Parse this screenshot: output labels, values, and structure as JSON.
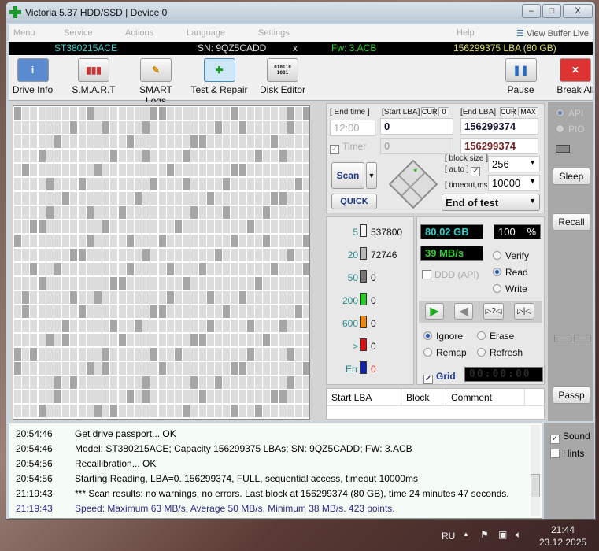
{
  "window": {
    "title": "Victoria 5.37 HDD/SSD | Device 0",
    "minimize": "–",
    "maximize": "□",
    "close": "X"
  },
  "menu": [
    "Menu",
    "Service",
    "Actions",
    "Language",
    "Settings",
    "Help"
  ],
  "view_buffer": "View Buffer Live",
  "info": {
    "model": "ST380215ACE",
    "serial": "SN: 9QZ5CADD",
    "close": "x",
    "firmware": "Fw: 3.ACB",
    "capacity": "156299375 LBA (80 GB)"
  },
  "toolbar": {
    "drive_info": "Drive Info",
    "smart": "S.M.A.R.T",
    "smart_logs": "SMART Logs",
    "test_repair": "Test & Repair",
    "disk_editor": "Disk Editor",
    "pause": "Pause",
    "break_all": "Break All"
  },
  "controls": {
    "end_time_label": "[ End time ]",
    "end_time": "12:00",
    "start_lba_label": "[Start LBA]",
    "cur": "CUR",
    "zero": "0",
    "end_lba_label": "[End LBA]",
    "max": "MAX",
    "start_lba": "0",
    "end_lba": "156299374",
    "timer": "Timer",
    "timer_value": "0",
    "end_lba2": "156299374",
    "scan": "Scan",
    "quick": "QUICK",
    "block_size_label": "[ block size ]",
    "auto_label": "[ auto ]",
    "block_size": "256",
    "timeout_label": "[ timeout,ms ]",
    "timeout": "10000",
    "end_action": "End of test"
  },
  "legend": [
    {
      "ms": "5",
      "count": "537800",
      "color": "#f4f4f4"
    },
    {
      "ms": "20",
      "count": "72746",
      "color": "#b8b8b8"
    },
    {
      "ms": "50",
      "count": "0",
      "color": "#777777"
    },
    {
      "ms": "200",
      "count": "0",
      "color": "#22cc22"
    },
    {
      "ms": "600",
      "count": "0",
      "color": "#ee8811"
    },
    {
      "ms": ">",
      "count": "0",
      "color": "#dd1111"
    },
    {
      "ms": "Err",
      "count": "0",
      "color": "#1122aa"
    }
  ],
  "status": {
    "size": "80,02 GB",
    "percent": "100",
    "percent_sign": "%",
    "speed": "39 MB/s",
    "ddd": "DDD (API)",
    "verify": "Verify",
    "read": "Read",
    "write": "Write",
    "ignore": "Ignore",
    "erase": "Erase",
    "remap": "Remap",
    "refresh": "Refresh",
    "grid": "Grid",
    "clock": "00:00:00"
  },
  "table": {
    "headers": [
      "Start LBA",
      "Block",
      "Comment"
    ]
  },
  "side": {
    "api": "API",
    "pio": "PIO",
    "sleep": "Sleep",
    "recall": "Recall",
    "passp": "Passp"
  },
  "log": [
    {
      "time": "20:54:46",
      "text": "Get drive passport... OK"
    },
    {
      "time": "20:54:46",
      "text": "Model: ST380215ACE; Capacity 156299375 LBAs; SN: 9QZ5CADD; FW: 3.ACB"
    },
    {
      "time": "20:54:56",
      "text": "Recallibration... OK"
    },
    {
      "time": "20:54:56",
      "text": "Starting Reading, LBA=0..156299374, FULL, sequential access, timeout 10000ms"
    },
    {
      "time": "21:19:43",
      "text": "*** Scan results: no warnings, no errors. Last block at 156299374 (80 GB), time 24 minutes 47 seconds."
    },
    {
      "time": "21:19:43",
      "text": "Speed: Maximum 63 MB/s. Average 50 MB/s. Minimum 38 MB/s. 423 points."
    }
  ],
  "options": {
    "sound": "Sound",
    "hints": "Hints"
  },
  "taskbar": {
    "lang": "RU",
    "time": "21:44",
    "date": "23.12.2025"
  }
}
